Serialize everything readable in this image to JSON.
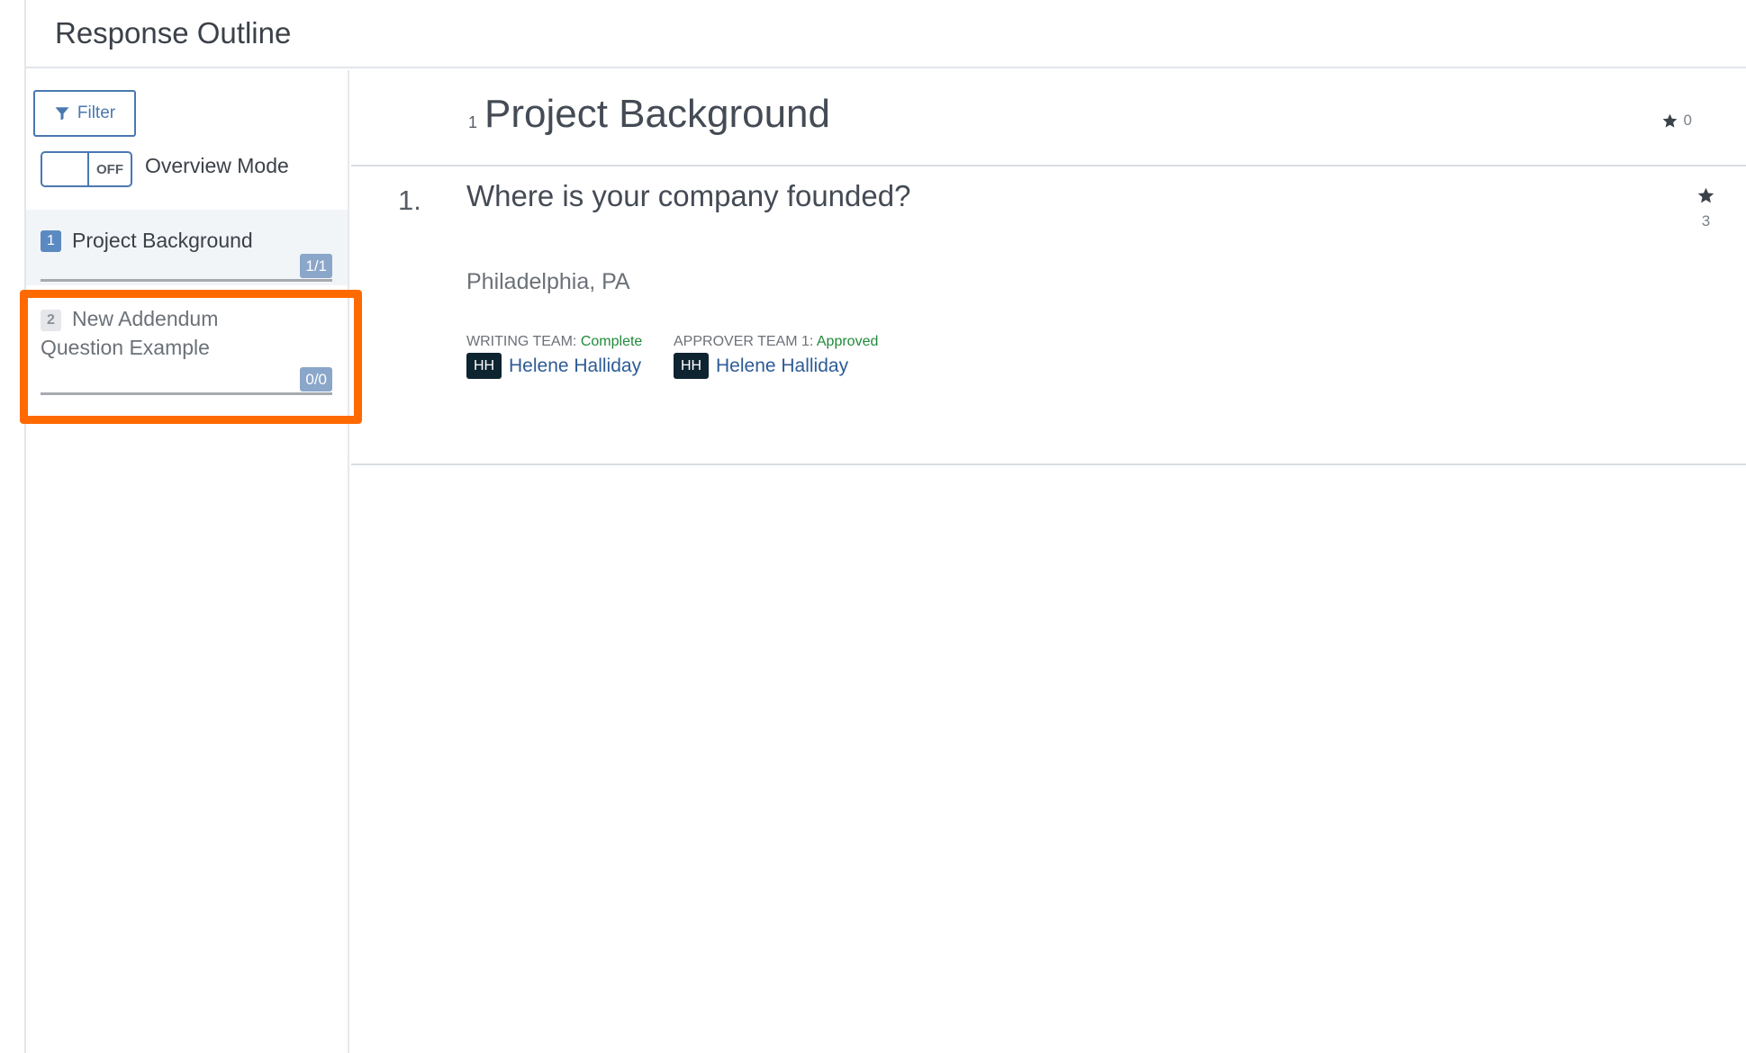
{
  "header": {
    "title": "Response Outline"
  },
  "sidebar": {
    "filter_label": "Filter",
    "toggle": {
      "state_label": "OFF",
      "label": "Overview Mode"
    },
    "sections": [
      {
        "number": "1",
        "title": "Project Background",
        "count": "1/1"
      },
      {
        "number": "2",
        "title": "New Addendum Question Example",
        "count": "0/0"
      }
    ]
  },
  "main": {
    "section": {
      "number": "1",
      "title": "Project Background",
      "star_count": "0"
    },
    "question": {
      "number": "1.",
      "text": "Where is your company founded?",
      "star_count": "3",
      "answer": "Philadelphia, PA",
      "teams": [
        {
          "label": "WRITING TEAM:",
          "status": "Complete",
          "assignee_initials": "HH",
          "assignee_name": "Helene Halliday"
        },
        {
          "label": "APPROVER TEAM 1:",
          "status": "Approved",
          "assignee_initials": "HH",
          "assignee_name": "Helene Halliday"
        }
      ]
    }
  },
  "colors": {
    "accent": "#4a78b0",
    "highlight": "#ff6a00",
    "status_green": "#1f8a3a",
    "avatar_bg": "#0f2431",
    "link_blue": "#2d5b95"
  }
}
